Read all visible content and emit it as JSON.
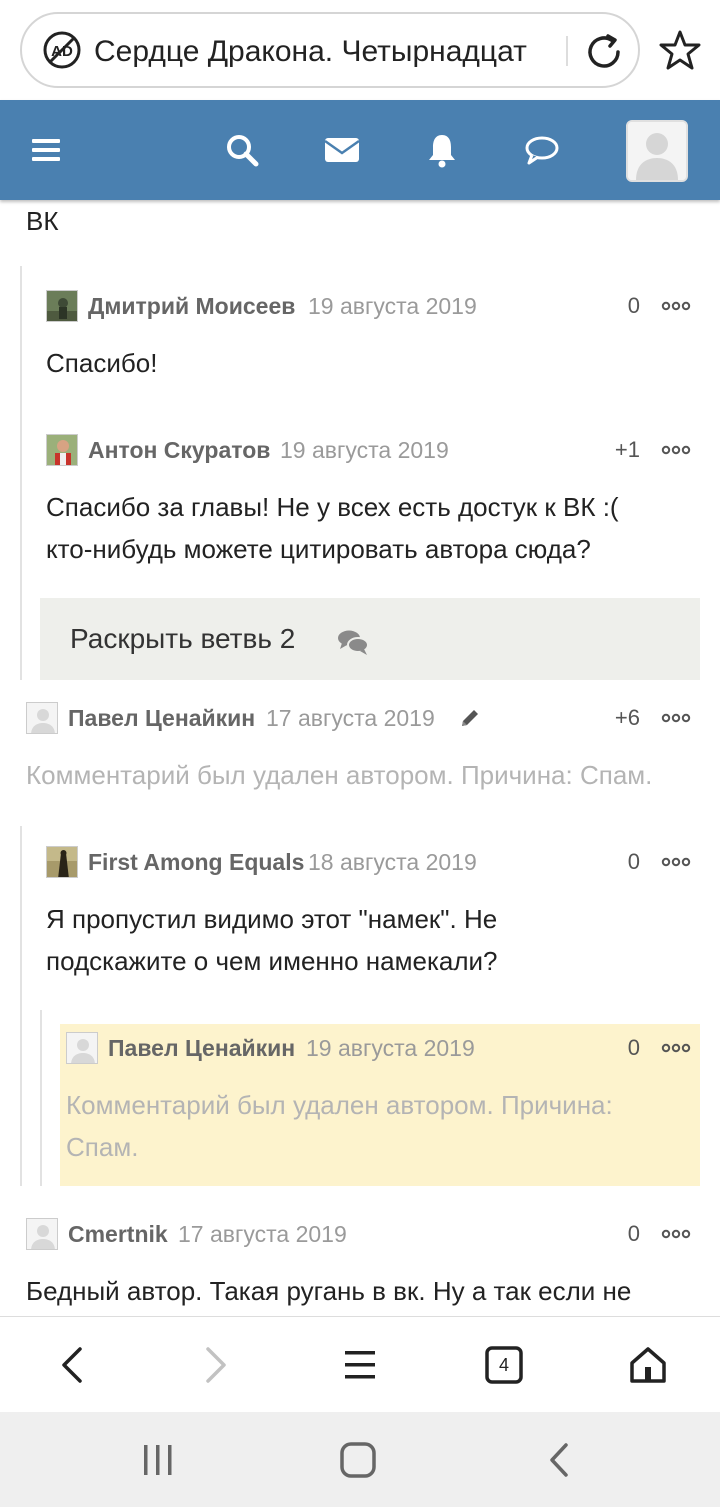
{
  "browser": {
    "url_title": "Сердце Дракона. Четырнадцат",
    "tabs_count": "4"
  },
  "content": {
    "top_fragment": "ВК",
    "comments": [
      {
        "author": "Дмитрий Моисеев",
        "date": "19 августа 2019",
        "score": "0",
        "text_lines": [
          "Спасибо!"
        ]
      },
      {
        "author": "Антон Скуратов",
        "date": "19 августа 2019",
        "score": "+1",
        "text_lines": [
          "Спасибо за главы! Не у всех есть достук к ВК :(",
          "кто-нибудь можете цитировать автора сюда?"
        ]
      },
      {
        "author": "Павел Ценайкин",
        "date": "17 августа 2019",
        "score": "+6",
        "text_lines": [
          "Комментарий был удален автором. Причина: Спам."
        ]
      },
      {
        "author": "First Among Equals",
        "date": "18 августа 2019",
        "score": "0",
        "text_lines": [
          "Я пропустил видимо этот \"намек\". Не",
          "подскажите о чем именно намекали?"
        ]
      },
      {
        "author": "Павел Ценайкин",
        "date": "19 августа 2019",
        "score": "0",
        "text_lines": [
          "Комментарий был удален автором. Причина:",
          "Спам."
        ]
      },
      {
        "author": "Cmertnik",
        "date": "17 августа 2019",
        "score": "0",
        "text_lines": [
          "Бедный автор. Такая ругань в вк. Ну а так если не"
        ]
      }
    ],
    "expand_thread_label": "Раскрыть ветвь 2"
  },
  "colors": {
    "header_bg": "#4a80b0",
    "highlight_bg": "#fdf3cd",
    "expand_bg": "#eeefeb"
  },
  "icons": {
    "header": [
      "menu-icon",
      "search-icon",
      "mail-icon",
      "bell-icon",
      "chat-icon",
      "user-avatar"
    ],
    "browser_nav": [
      "back-icon",
      "forward-icon",
      "menu-icon",
      "tabs-icon",
      "home-icon"
    ],
    "system_nav": [
      "recents-icon",
      "home-icon",
      "back-icon"
    ]
  }
}
